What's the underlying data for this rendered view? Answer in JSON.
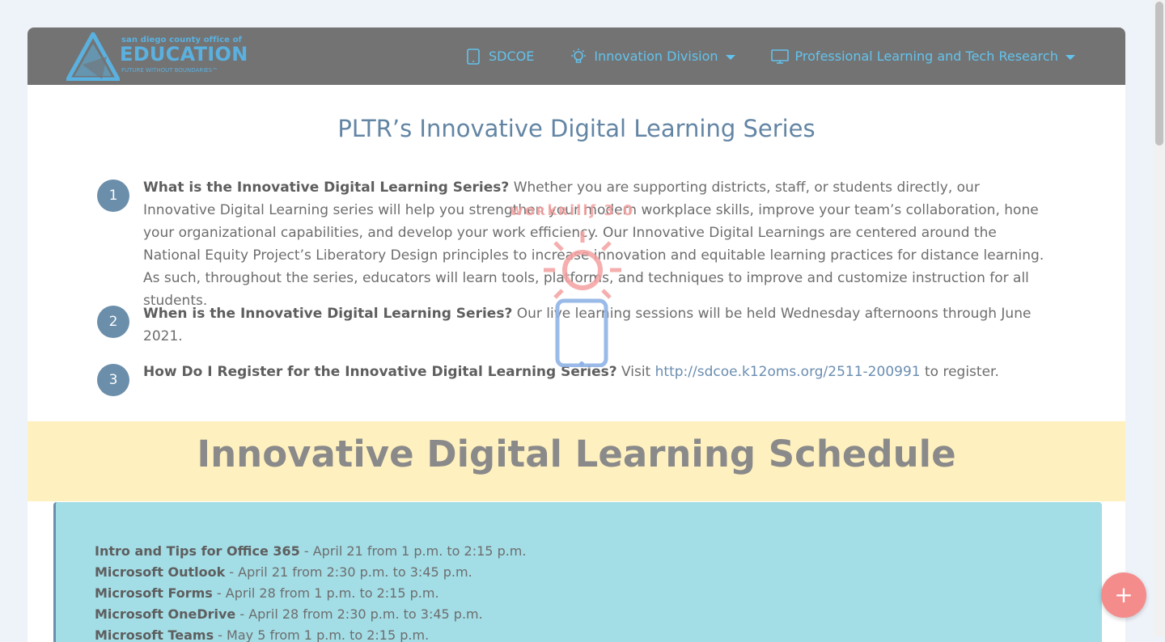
{
  "logo": {
    "top_text": "san diego county office of",
    "main_text": "EDUCATION",
    "sub_text": "FUTURE WITHOUT BOUNDARIES™"
  },
  "nav": {
    "items": [
      {
        "label": "SDCOE",
        "icon": "tablet-icon",
        "has_dropdown": false
      },
      {
        "label": "Innovation Division",
        "icon": "lightbulb-icon",
        "has_dropdown": true
      },
      {
        "label": "Professional Learning and Tech Research",
        "icon": "monitor-icon",
        "has_dropdown": true
      }
    ]
  },
  "intro": {
    "title": "PLTR’s Innovative Digital Learning Series",
    "faqs": [
      {
        "num": "1",
        "question": "What is the Innovative Digital Learning Series?",
        "answer": "Whether you are supporting districts, staff, or students directly, our Innovative Digital Learning series will help you strengthen your modern workplace skills, improve your team’s collaboration, hone your organizational capabilities, and develop your work efficiency. Our Innovative Digital Learnings are centered around the National Equity Project’s Liberatory Design principles to increase innovation and equitable learning practices for distance learning. As such, throughout the series, educators will learn tools, platforms, and techniques to improve and customize instruction for all students."
      },
      {
        "num": "2",
        "question": "When is the Innovative Digital Learning Series?",
        "answer": "Our live learning sessions will be held Wednesday afternoons through June 2021."
      },
      {
        "num": "3",
        "question": "How Do I Register for the Innovative Digital Learning Series?",
        "answer_prefix": "Visit",
        "link": "http://sdcoe.k12oms.org/2511-200991",
        "answer_suffix": "to register."
      }
    ]
  },
  "schedule": {
    "title": "Innovative Digital Learning Schedule",
    "items": [
      {
        "name": "Intro and Tips for Office 365",
        "when": " - April 21 from 1 p.m. to 2:15 p.m."
      },
      {
        "name": "Microsoft Outlook",
        "when": " - April 21 from 2:30 p.m. to 3:45 p.m."
      },
      {
        "name": "Microsoft Forms",
        "when": " - April 28 from 1 p.m. to 2:15 p.m."
      },
      {
        "name": "Microsoft OneDrive",
        "when": " - April 28 from 2:30 p.m. to 3:45 p.m."
      },
      {
        "name": "Microsoft Teams",
        "when": " - May 5 from 1 p.m. to 2:15 p.m."
      }
    ]
  },
  "fab": {
    "label": "+"
  },
  "watermark": {
    "text": "woʀkʀillʃ 3.0"
  },
  "colors": {
    "navbar": "#737373",
    "nav_link": "#63c3ed",
    "title": "#6385a4",
    "banner": "#fff1bf",
    "schedule_bg": "#a3dde6",
    "fab": "#f58c8c"
  }
}
